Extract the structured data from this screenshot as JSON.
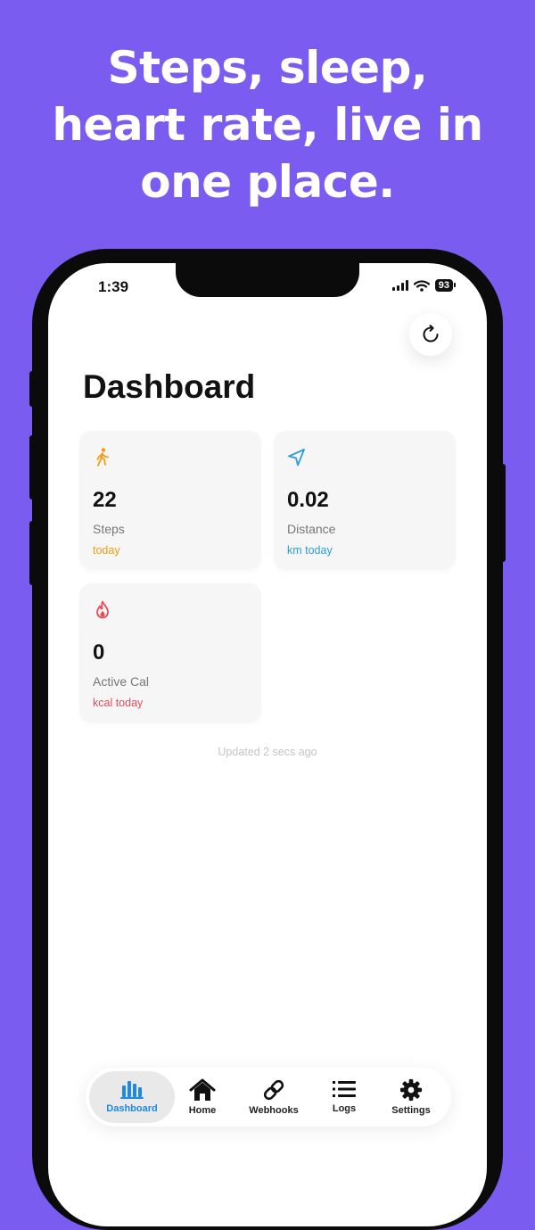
{
  "headline": [
    "Steps, sleep,",
    "heart rate, live in",
    "one place."
  ],
  "status_bar": {
    "time": "1:39",
    "battery": "93"
  },
  "page": {
    "title": "Dashboard",
    "updated": "Updated 2 secs ago"
  },
  "cards": {
    "steps": {
      "value": "22",
      "label": "Steps",
      "unit": "today",
      "accent": "#F39C12",
      "icon": "walking-icon"
    },
    "distance": {
      "value": "0.02",
      "label": "Distance",
      "unit": "km today",
      "accent": "#2D9CDB",
      "icon": "navigation-arrow-icon"
    },
    "calories": {
      "value": "0",
      "label": "Active Cal",
      "unit": "kcal today",
      "accent": "#E84C5A",
      "icon": "flame-icon"
    }
  },
  "tabs": [
    {
      "label": "Dashboard",
      "icon": "bar-chart-icon",
      "active": true
    },
    {
      "label": "Home",
      "icon": "home-icon"
    },
    {
      "label": "Webhooks",
      "icon": "link-icon"
    },
    {
      "label": "Logs",
      "icon": "list-icon"
    },
    {
      "label": "Settings",
      "icon": "gear-icon"
    }
  ],
  "colors": {
    "background": "#7B5CF0",
    "active_tab": "#1E88E5"
  }
}
